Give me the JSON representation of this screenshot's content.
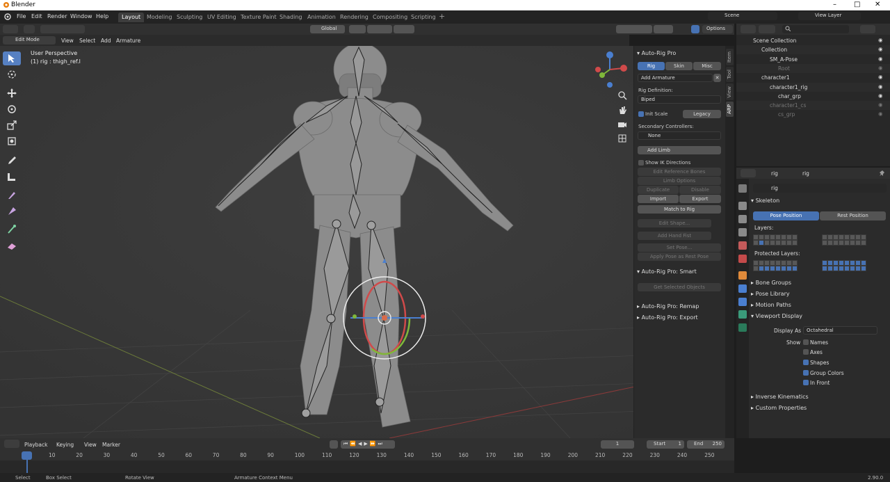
{
  "window": {
    "title": "Blender",
    "version": "2.90.0"
  },
  "menubar": {
    "menus": [
      "File",
      "Edit",
      "Render",
      "Window",
      "Help"
    ],
    "workspaces": [
      "Layout",
      "Modeling",
      "Sculpting",
      "UV Editing",
      "Texture Paint",
      "Shading",
      "Animation",
      "Rendering",
      "Compositing",
      "Scripting"
    ],
    "active_workspace": "Layout",
    "scene": "Scene",
    "view_layer": "View Layer"
  },
  "viewport_header": {
    "orientation": "Global",
    "options": "Options",
    "mode": "Edit Mode",
    "menus": [
      "View",
      "Select",
      "Add",
      "Armature"
    ]
  },
  "viewport": {
    "perspective": "User Perspective",
    "active_object": "(1) rig : thigh_ref.l"
  },
  "npanel": {
    "tabs": [
      "Item",
      "Tool",
      "View",
      "ARP"
    ],
    "active_tab": "ARP",
    "title": "Auto-Rig Pro",
    "subtabs": [
      "Rig",
      "Skin",
      "Misc"
    ],
    "add_armature": "Add Armature",
    "rig_definition_label": "Rig Definition:",
    "rig_definition": "Biped",
    "init_scale": "Init Scale",
    "legacy": "Legacy",
    "secondary_label": "Secondary Controllers:",
    "secondary": "None",
    "add_limb": "Add Limb",
    "show_ik": "Show IK Directions",
    "edit_ref_bones": "Edit Reference Bones",
    "limb_options": "Limb Options",
    "duplicate": "Duplicate",
    "disable": "Disable",
    "import": "Import",
    "export": "Export",
    "match_to_rig": "Match to Rig",
    "edit_shape": "Edit Shape...",
    "add_hand_fist": "Add Hand Fist",
    "set_pose": "Set Pose...",
    "apply_pose": "Apply Pose as Rest Pose",
    "smart_title": "Auto-Rig Pro: Smart",
    "get_selected": "Get Selected Objects",
    "remap_title": "Auto-Rig Pro: Remap",
    "export_title": "Auto-Rig Pro: Export"
  },
  "outliner": {
    "rows": [
      {
        "label": "Scene Collection",
        "indent": 0,
        "dim": false
      },
      {
        "label": "Collection",
        "indent": 1,
        "dim": false
      },
      {
        "label": "SM_A-Pose",
        "indent": 2,
        "dim": false
      },
      {
        "label": "Root",
        "indent": 3,
        "dim": true
      },
      {
        "label": "character1",
        "indent": 1,
        "dim": false
      },
      {
        "label": "character1_rig",
        "indent": 2,
        "dim": false
      },
      {
        "label": "char_grp",
        "indent": 3,
        "dim": false
      },
      {
        "label": "character1_cs",
        "indent": 2,
        "dim": true
      },
      {
        "label": "cs_grp",
        "indent": 3,
        "dim": true
      }
    ]
  },
  "properties": {
    "breadcrumb_a": "rig",
    "breadcrumb_b": "rig",
    "name_field": "rig",
    "skeleton": "Skeleton",
    "pose_position": "Pose Position",
    "rest_position": "Rest Position",
    "layers": "Layers:",
    "protected_layers": "Protected Layers:",
    "bone_groups": "Bone Groups",
    "pose_library": "Pose Library",
    "motion_paths": "Motion Paths",
    "viewport_display": "Viewport Display",
    "display_as_label": "Display As",
    "display_as": "Octahedral",
    "show_label": "Show",
    "show_names": "Names",
    "show_axes": "Axes",
    "show_shapes": "Shapes",
    "group_colors": "Group Colors",
    "in_front": "In Front",
    "inverse_kinematics": "Inverse Kinematics",
    "custom_properties": "Custom Properties"
  },
  "timeline": {
    "menus": [
      "Playback",
      "Keying",
      "View",
      "Marker"
    ],
    "current_frame": "1",
    "start_label": "Start",
    "start": "1",
    "end_label": "End",
    "end": "250",
    "ticks": [
      "1",
      "10",
      "20",
      "30",
      "40",
      "50",
      "60",
      "70",
      "80",
      "90",
      "100",
      "110",
      "120",
      "130",
      "140",
      "150",
      "160",
      "170",
      "180",
      "190",
      "200",
      "210",
      "220",
      "230",
      "240",
      "250"
    ]
  },
  "statusbar": {
    "select": "Select",
    "box_select": "Box Select",
    "rotate_view": "Rotate View",
    "context_menu": "Armature Context Menu"
  },
  "colors": {
    "accent": "#4772b3",
    "bg": "#3a3a3a",
    "x_axis": "#d04a4a",
    "y_axis": "#7fb83a",
    "z_axis": "#4a7fd0"
  }
}
